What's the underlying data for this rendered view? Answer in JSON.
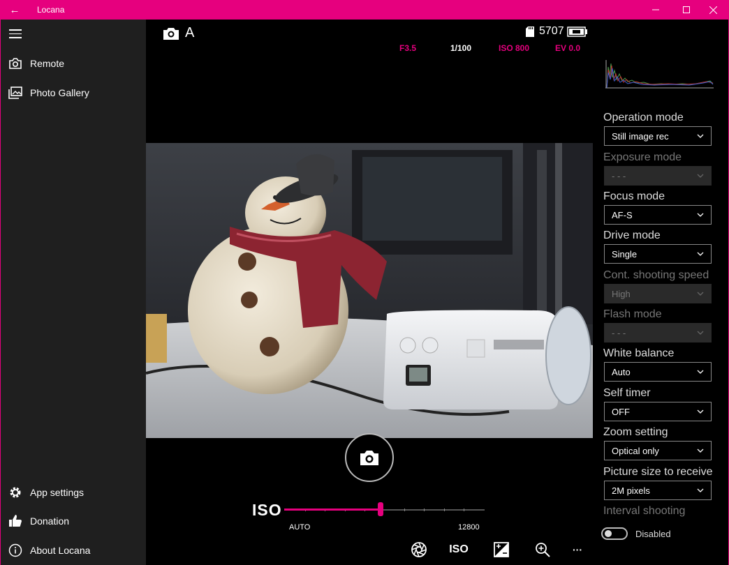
{
  "titlebar": {
    "back": "←",
    "title": "Locana",
    "minimize": "—",
    "maximize": "☐",
    "close": "✕"
  },
  "sidebar": {
    "items": [
      {
        "label": "Remote"
      },
      {
        "label": "Photo Gallery"
      }
    ],
    "footer_items": [
      {
        "label": "App settings"
      },
      {
        "label": "Donation"
      },
      {
        "label": "About Locana"
      }
    ]
  },
  "camera": {
    "mode_letter": "A",
    "remaining_shots": "5707",
    "params": {
      "aperture": "F3.5",
      "shutter": "1/100",
      "iso": "ISO 800",
      "ev": "EV 0.0"
    }
  },
  "iso_slider": {
    "label": "ISO",
    "min_label": "AUTO",
    "max_label": "12800",
    "value_fraction": 0.48
  },
  "bottom_bar": {
    "iso_button": "ISO",
    "more": "···"
  },
  "settings": {
    "operation_mode": {
      "label": "Operation mode",
      "value": "Still image rec"
    },
    "exposure_mode": {
      "label": "Exposure mode",
      "value": "- - -"
    },
    "focus_mode": {
      "label": "Focus mode",
      "value": "AF-S"
    },
    "drive_mode": {
      "label": "Drive mode",
      "value": "Single"
    },
    "cont_speed": {
      "label": "Cont. shooting speed",
      "value": "High"
    },
    "flash_mode": {
      "label": "Flash mode",
      "value": "- - -"
    },
    "white_balance": {
      "label": "White balance",
      "value": "Auto"
    },
    "self_timer": {
      "label": "Self timer",
      "value": "OFF"
    },
    "zoom_setting": {
      "label": "Zoom setting",
      "value": "Optical only"
    },
    "picture_size": {
      "label": "Picture size to receive",
      "value": "2M pixels"
    },
    "interval_shooting": {
      "label": "Interval shooting",
      "state": "Disabled"
    }
  },
  "colors": {
    "accent": "#e6007e",
    "sidebar_bg": "#1f1f1f",
    "background": "#000000"
  }
}
